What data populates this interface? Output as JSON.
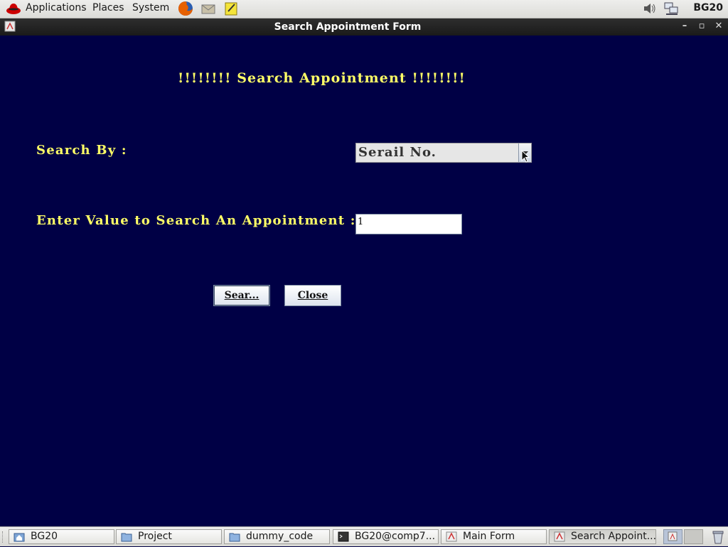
{
  "panel": {
    "menus": [
      "Applications",
      "Places",
      "System"
    ],
    "clock": "BG20"
  },
  "window": {
    "title": "Search Appointment Form"
  },
  "form": {
    "heading": "!!!!!!!! Search Appointment !!!!!!!!",
    "search_by_label": "Search By :",
    "search_by_selected": "Serail No.",
    "value_label": "Enter Value to Search An Appointment :",
    "value_input": "1",
    "search_button": "Sear...",
    "close_button": "Close"
  },
  "taskbar": {
    "items": [
      {
        "label": "BG20",
        "icon": "home-folder-icon"
      },
      {
        "label": "Project",
        "icon": "folder-icon"
      },
      {
        "label": "dummy_code",
        "icon": "folder-icon"
      },
      {
        "label": "BG20@comp7...",
        "icon": "terminal-icon"
      },
      {
        "label": "Main Form",
        "icon": "java-app-icon"
      },
      {
        "label": "Search Appoint...",
        "icon": "java-app-icon"
      }
    ]
  },
  "colors": {
    "background": "#000045",
    "label_text": "#ffff66"
  }
}
